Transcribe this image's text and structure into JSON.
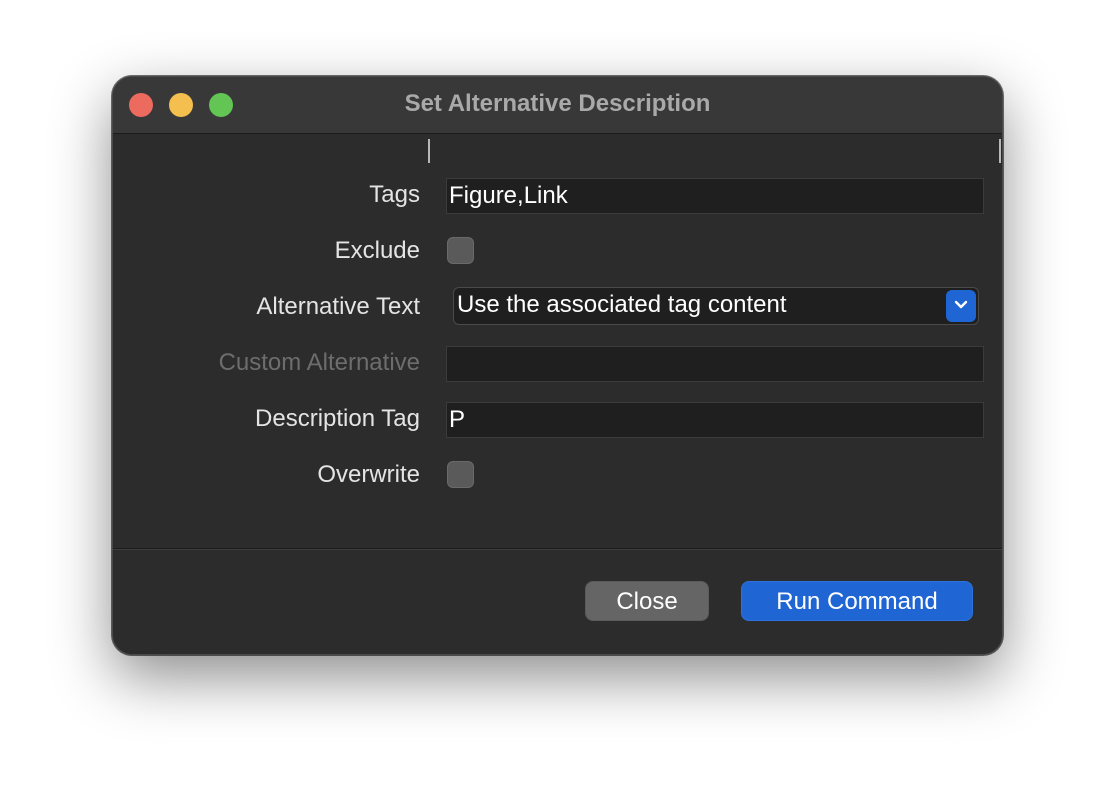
{
  "window": {
    "title": "Set Alternative Description"
  },
  "form": {
    "tags": {
      "label": "Tags",
      "value": "Figure,Link"
    },
    "exclude": {
      "label": "Exclude",
      "checked": false
    },
    "alternative_text": {
      "label": "Alternative Text",
      "selected": "Use the associated tag content"
    },
    "custom_alternative": {
      "label": "Custom Alternative",
      "value": "",
      "enabled": false
    },
    "description_tag": {
      "label": "Description Tag",
      "value": "P"
    },
    "overwrite": {
      "label": "Overwrite",
      "checked": false
    }
  },
  "buttons": {
    "close": "Close",
    "run": "Run Command"
  },
  "icons": {
    "dropdown": "chevron-down-icon",
    "traffic_close": "close-window-icon",
    "traffic_minimize": "minimize-window-icon",
    "traffic_zoom": "zoom-window-icon"
  },
  "colors": {
    "accent": "#1f66d4",
    "window_bg": "#2c2c2c",
    "titlebar_bg": "#383838",
    "field_bg": "#1f1f1f"
  }
}
